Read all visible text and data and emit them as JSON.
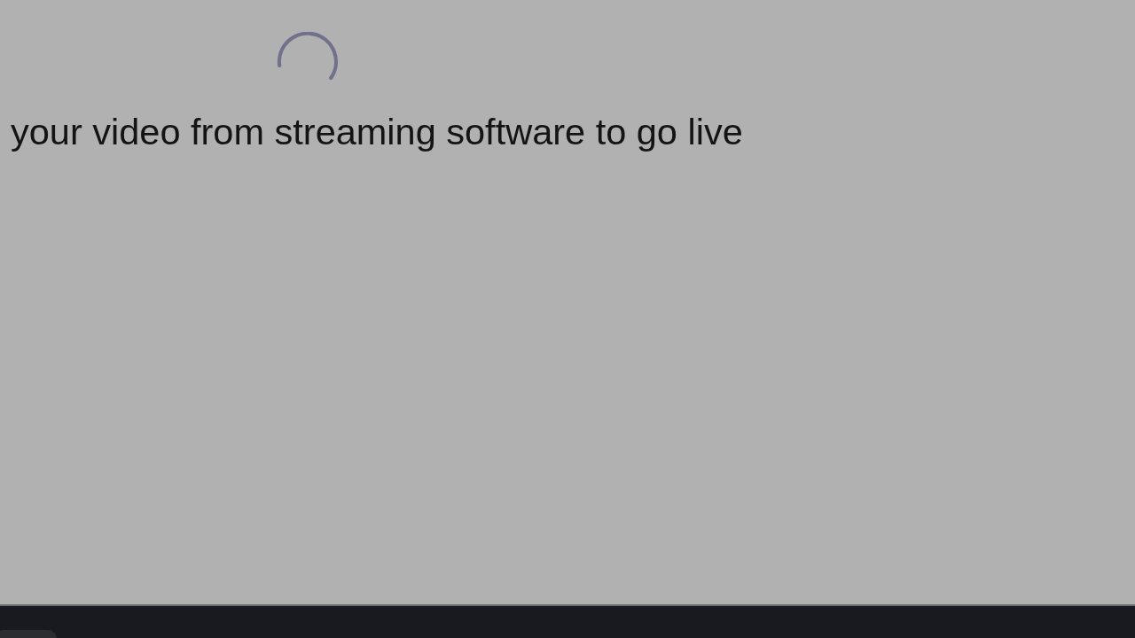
{
  "message": "your video from streaming software to go live"
}
